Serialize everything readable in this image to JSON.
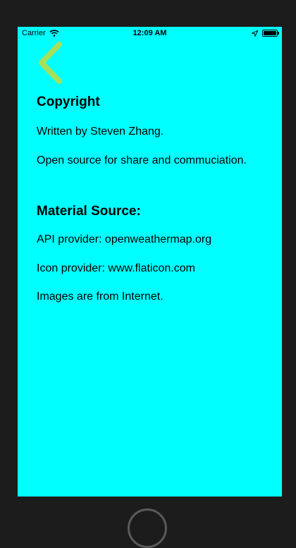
{
  "status_bar": {
    "carrier": "Carrier",
    "time": "12:09 AM",
    "wifi_icon": "wifi-icon",
    "location_icon": "location-arrow-icon",
    "battery_icon": "battery-full-icon"
  },
  "nav": {
    "back_icon": "chevron-left-icon",
    "back_color": "#a6e05a"
  },
  "copyright": {
    "title": "Copyright",
    "lines": [
      "Written by Steven Zhang.",
      "Open source for share and commuciation."
    ]
  },
  "material": {
    "title": "Material Source:",
    "lines": [
      "API provider: openweathermap.org",
      "Icon provider: www.flaticon.com",
      "Images are from Internet."
    ]
  },
  "colors": {
    "screen_background": "#00ffff",
    "frame": "#1c1c1c"
  }
}
